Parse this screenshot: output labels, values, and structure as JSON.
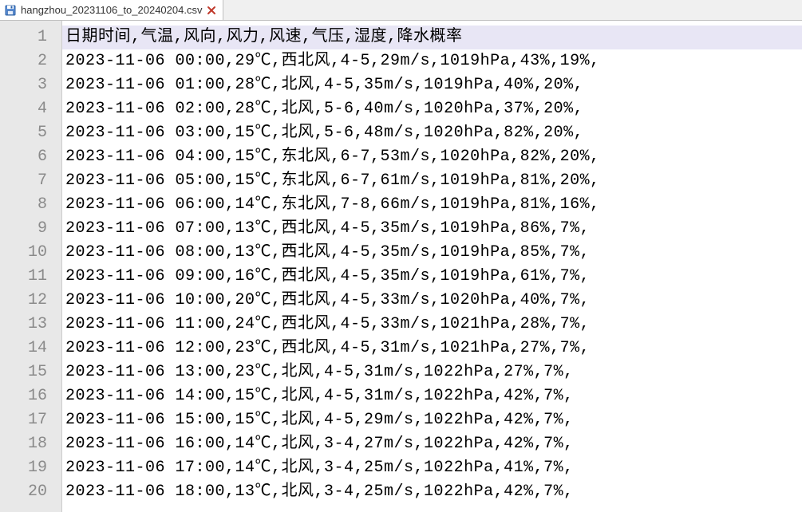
{
  "tab": {
    "filename": "hangzhou_20231106_to_20240204.csv"
  },
  "csv": {
    "header": "日期时间,气温,风向,风力,风速,气压,湿度,降水概率",
    "rows": [
      "2023-11-06 00:00,29℃,西北风,4-5,29m/s,1019hPa,43%,19%,",
      "2023-11-06 01:00,28℃,北风,4-5,35m/s,1019hPa,40%,20%,",
      "2023-11-06 02:00,28℃,北风,5-6,40m/s,1020hPa,37%,20%,",
      "2023-11-06 03:00,15℃,北风,5-6,48m/s,1020hPa,82%,20%,",
      "2023-11-06 04:00,15℃,东北风,6-7,53m/s,1020hPa,82%,20%,",
      "2023-11-06 05:00,15℃,东北风,6-7,61m/s,1019hPa,81%,20%,",
      "2023-11-06 06:00,14℃,东北风,7-8,66m/s,1019hPa,81%,16%,",
      "2023-11-06 07:00,13℃,西北风,4-5,35m/s,1019hPa,86%,7%,",
      "2023-11-06 08:00,13℃,西北风,4-5,35m/s,1019hPa,85%,7%,",
      "2023-11-06 09:00,16℃,西北风,4-5,35m/s,1019hPa,61%,7%,",
      "2023-11-06 10:00,20℃,西北风,4-5,33m/s,1020hPa,40%,7%,",
      "2023-11-06 11:00,24℃,西北风,4-5,33m/s,1021hPa,28%,7%,",
      "2023-11-06 12:00,23℃,西北风,4-5,31m/s,1021hPa,27%,7%,",
      "2023-11-06 13:00,23℃,北风,4-5,31m/s,1022hPa,27%,7%,",
      "2023-11-06 14:00,15℃,北风,4-5,31m/s,1022hPa,42%,7%,",
      "2023-11-06 15:00,15℃,北风,4-5,29m/s,1022hPa,42%,7%,",
      "2023-11-06 16:00,14℃,北风,3-4,27m/s,1022hPa,42%,7%,",
      "2023-11-06 17:00,14℃,北风,3-4,25m/s,1022hPa,41%,7%,",
      "2023-11-06 18:00,13℃,北风,3-4,25m/s,1022hPa,42%,7%,"
    ]
  },
  "line_numbers": [
    "1",
    "2",
    "3",
    "4",
    "5",
    "6",
    "7",
    "8",
    "9",
    "10",
    "11",
    "12",
    "13",
    "14",
    "15",
    "16",
    "17",
    "18",
    "19",
    "20"
  ]
}
